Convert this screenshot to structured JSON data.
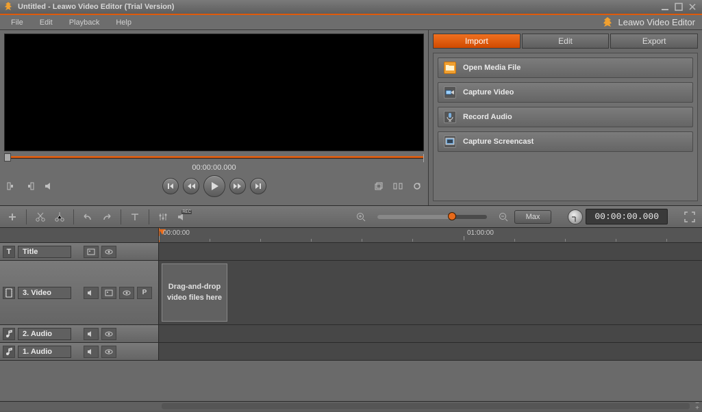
{
  "window": {
    "title": "Untitled - Leawo Video Editor (Trial Version)"
  },
  "brand": "Leawo Video Editor",
  "menubar": {
    "file": "File",
    "edit": "Edit",
    "playback": "Playback",
    "help": "Help"
  },
  "preview": {
    "timecode": "00:00:00.000"
  },
  "right_tabs": {
    "import": "Import",
    "edit": "Edit",
    "export": "Export"
  },
  "import_items": {
    "open_media": "Open Media File",
    "capture_video": "Capture Video",
    "record_audio": "Record Audio",
    "capture_screencast": "Capture Screencast"
  },
  "toolbar": {
    "max": "Max",
    "timecode": "00:00:00.000"
  },
  "ruler": {
    "t0": "00:00:00",
    "t1": "01:00:00"
  },
  "tracks": {
    "title": {
      "label": "Title"
    },
    "video": {
      "label": "3. Video",
      "drop_hint": "Drag-and-drop video files here"
    },
    "audio2": {
      "label": "2. Audio"
    },
    "audio1": {
      "label": "1. Audio"
    }
  }
}
